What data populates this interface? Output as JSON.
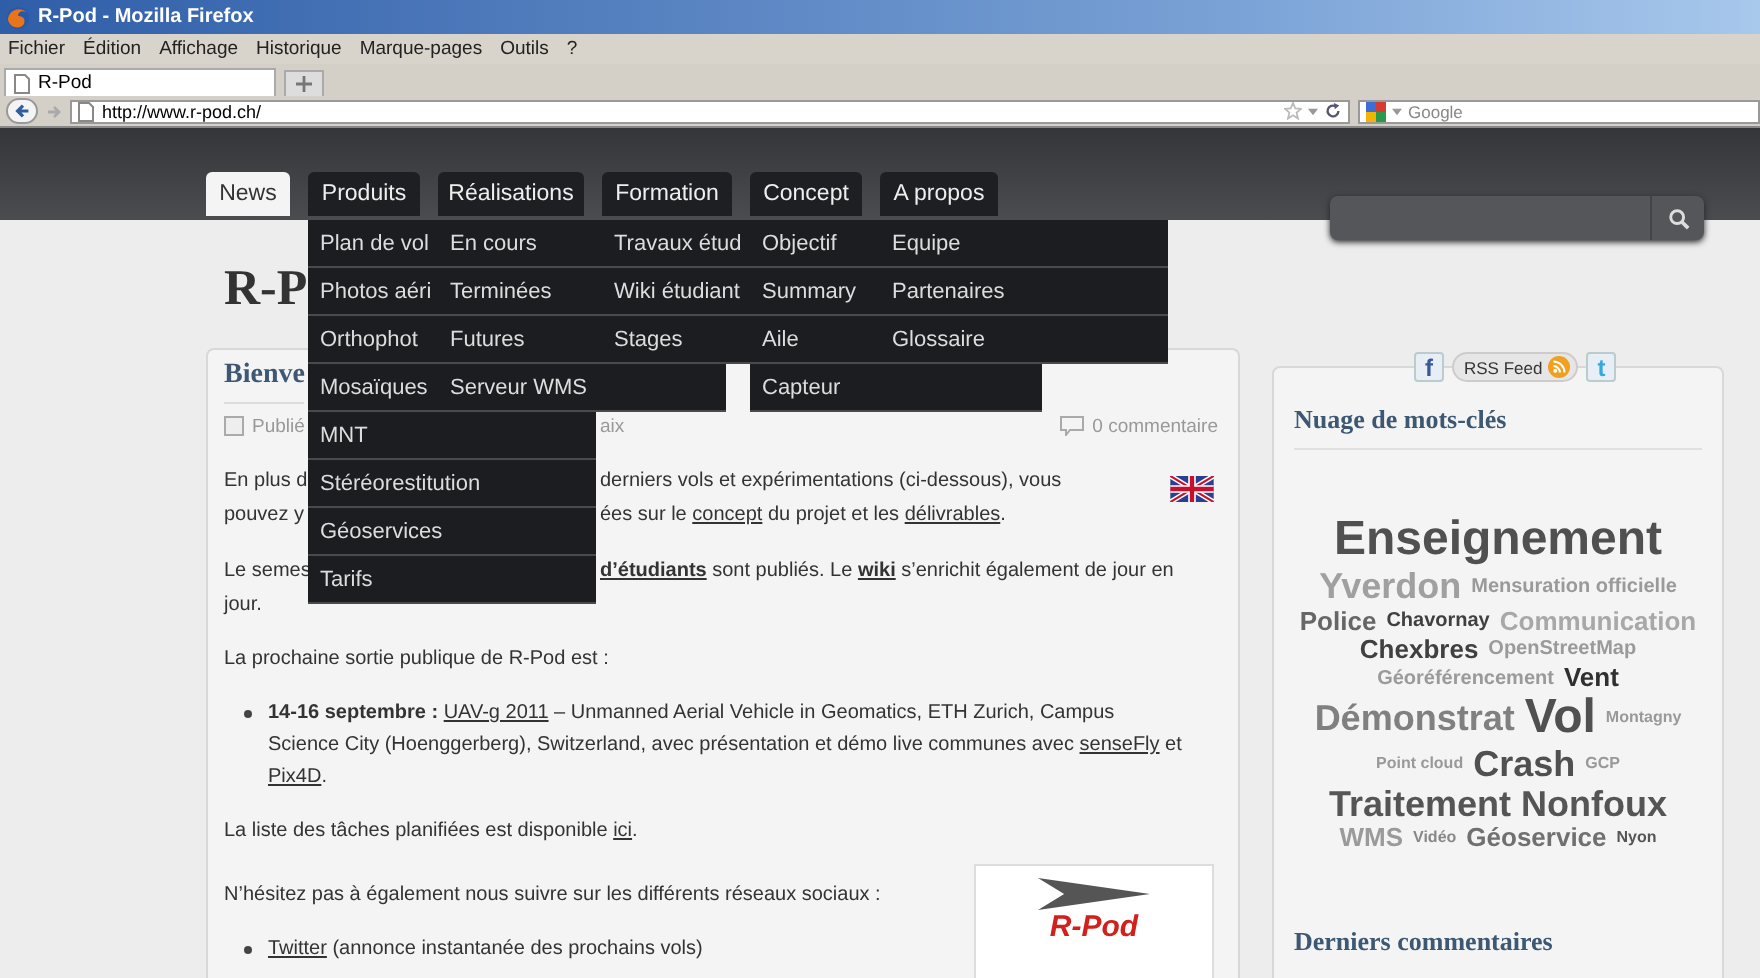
{
  "browser": {
    "title": "R-Pod - Mozilla Firefox",
    "menu": [
      "Fichier",
      "Édition",
      "Affichage",
      "Historique",
      "Marque-pages",
      "Outils",
      "?"
    ],
    "tabs": [
      {
        "label": "R-Pod",
        "selected": true
      }
    ],
    "url": "http://www.r-pod.ch/",
    "search_placeholder": "Google"
  },
  "header": {
    "nav": [
      {
        "label": "News",
        "selected": true
      },
      {
        "label": "Produits",
        "selected": false,
        "items": [
          "Plan de vol",
          "Photos aéri",
          "Orthophot",
          "Mosaïques",
          "MNT",
          "Stéréorestitution",
          "Géoservices",
          "Tarifs"
        ]
      },
      {
        "label": "Réalisations",
        "selected": false,
        "items": [
          "En cours",
          "Terminées",
          "Futures",
          "Serveur WMS"
        ]
      },
      {
        "label": "Formation",
        "selected": false,
        "items": [
          "Travaux étud",
          "Wiki étudiant",
          "Stages"
        ]
      },
      {
        "label": "Concept",
        "selected": false,
        "items": [
          "Objectif",
          "Summary",
          "Aile",
          "Capteur"
        ]
      },
      {
        "label": "A propos",
        "selected": false,
        "items": [
          "Equipe",
          "Partenaires",
          "Glossaire"
        ]
      }
    ]
  },
  "site_title": "R-P",
  "post": {
    "title": "Bienve",
    "meta_left": "Publié",
    "meta_fragment": "aix",
    "comments": "0 commentaire",
    "intro_lines": [
      {
        "left": "En plus d",
        "right": [
          {
            "kind": "text",
            "text": "derniers vols et expérimentations (ci-dessous), vous"
          }
        ]
      },
      {
        "left": "pouvez y",
        "right": [
          {
            "kind": "text",
            "text": "ées sur le "
          },
          {
            "kind": "link",
            "text": "concept"
          },
          {
            "kind": "text",
            "text": " du projet et les "
          },
          {
            "kind": "link",
            "text": "délivrables"
          },
          {
            "kind": "text",
            "text": "."
          }
        ]
      }
    ],
    "semester_lines": [
      {
        "left": "Le semes",
        "right": [
          {
            "kind": "bold-link",
            "text": "d’étudiants"
          },
          {
            "kind": "text",
            "text": " sont publiés. Le "
          },
          {
            "kind": "bold-link",
            "text": "wiki"
          },
          {
            "kind": "text",
            "text": " s’enrichit également de jour en"
          }
        ]
      },
      {
        "left": "jour."
      }
    ],
    "blocks": [
      {
        "kind": "paragraph",
        "segments": [
          {
            "kind": "text",
            "text": "La prochaine sortie publique de R-Pod est :"
          }
        ]
      },
      {
        "kind": "bullet",
        "segments": [
          {
            "kind": "bold",
            "text": "14-16 septembre : "
          },
          {
            "kind": "link",
            "text": "UAV-g 2011"
          },
          {
            "kind": "text",
            "text": " – Unmanned Aerial Vehicle in Geomatics, ETH Zurich, Campus Science City (Hoenggerberg), Switzerland, avec présentation et démo live communes avec "
          },
          {
            "kind": "link",
            "text": "senseFly"
          },
          {
            "kind": "text",
            "text": " et "
          },
          {
            "kind": "link",
            "text": "Pix4D"
          },
          {
            "kind": "text",
            "text": "."
          }
        ]
      },
      {
        "kind": "paragraph",
        "segments": [
          {
            "kind": "text",
            "text": "La liste des tâches planifiées est disponible "
          },
          {
            "kind": "link",
            "text": "ici"
          },
          {
            "kind": "text",
            "text": "."
          }
        ]
      }
    ],
    "social_blocks": [
      {
        "kind": "paragraph",
        "segments": [
          {
            "kind": "text",
            "text": "N’hésitez pas à également nous suivre sur les différents réseaux sociaux :"
          }
        ]
      },
      {
        "kind": "bullet",
        "segments": [
          {
            "kind": "link",
            "text": "Twitter"
          },
          {
            "kind": "text",
            "text": " (annonce instantanée des prochains vols)"
          }
        ]
      }
    ],
    "logo_text": "R-Pod"
  },
  "sidebar": {
    "facebook_glyph": "f",
    "rss_label": "RSS Feed",
    "twitter_glyph": "t",
    "cloud_title": "Nuage de mots-clés",
    "tags": [
      {
        "text": "Enseignement",
        "kind": "xl",
        "color": "#505050"
      },
      {
        "text": "Yverdon",
        "kind": "l",
        "color": "#a0a0a0"
      },
      {
        "text": "Mensuration officielle",
        "kind": "s",
        "color": "#9a9a9a"
      },
      {
        "text": "Police",
        "kind": "m",
        "color": "#666666"
      },
      {
        "text": "Chavornay",
        "kind": "s",
        "color": "#404040"
      },
      {
        "text": "Communication",
        "kind": "m",
        "color": "#a8a8a8"
      },
      {
        "text": "Chexbres",
        "kind": "m",
        "color": "#404040"
      },
      {
        "text": "OpenStreetMap",
        "kind": "s",
        "color": "#9a9a9a"
      },
      {
        "text": "Géoréférencement",
        "kind": "s",
        "color": "#9a9a9a"
      },
      {
        "text": "Vent",
        "kind": "m",
        "color": "#303030"
      },
      {
        "text": "Démonstrat",
        "kind": "l",
        "color": "#808080"
      },
      {
        "text": "Vol",
        "kind": "xl",
        "color": "#505050"
      },
      {
        "text": "Montagny",
        "kind": "xs",
        "color": "#999999"
      },
      {
        "text": "Point cloud",
        "kind": "xs",
        "color": "#999999"
      },
      {
        "text": "Crash",
        "kind": "l",
        "color": "#505050"
      },
      {
        "text": "GCP",
        "kind": "xs",
        "color": "#999999"
      },
      {
        "text": "Traitement",
        "kind": "l",
        "color": "#555555"
      },
      {
        "text": "Nonfoux",
        "kind": "l",
        "color": "#555555"
      },
      {
        "text": "WMS",
        "kind": "m",
        "color": "#9a9a9a"
      },
      {
        "text": "Vidéo",
        "kind": "xs",
        "color": "#888888"
      },
      {
        "text": "Géoservice",
        "kind": "m",
        "color": "#707070"
      },
      {
        "text": "Nyon",
        "kind": "xs",
        "color": "#555555"
      }
    ],
    "recent_title": "Derniers commentaires"
  }
}
